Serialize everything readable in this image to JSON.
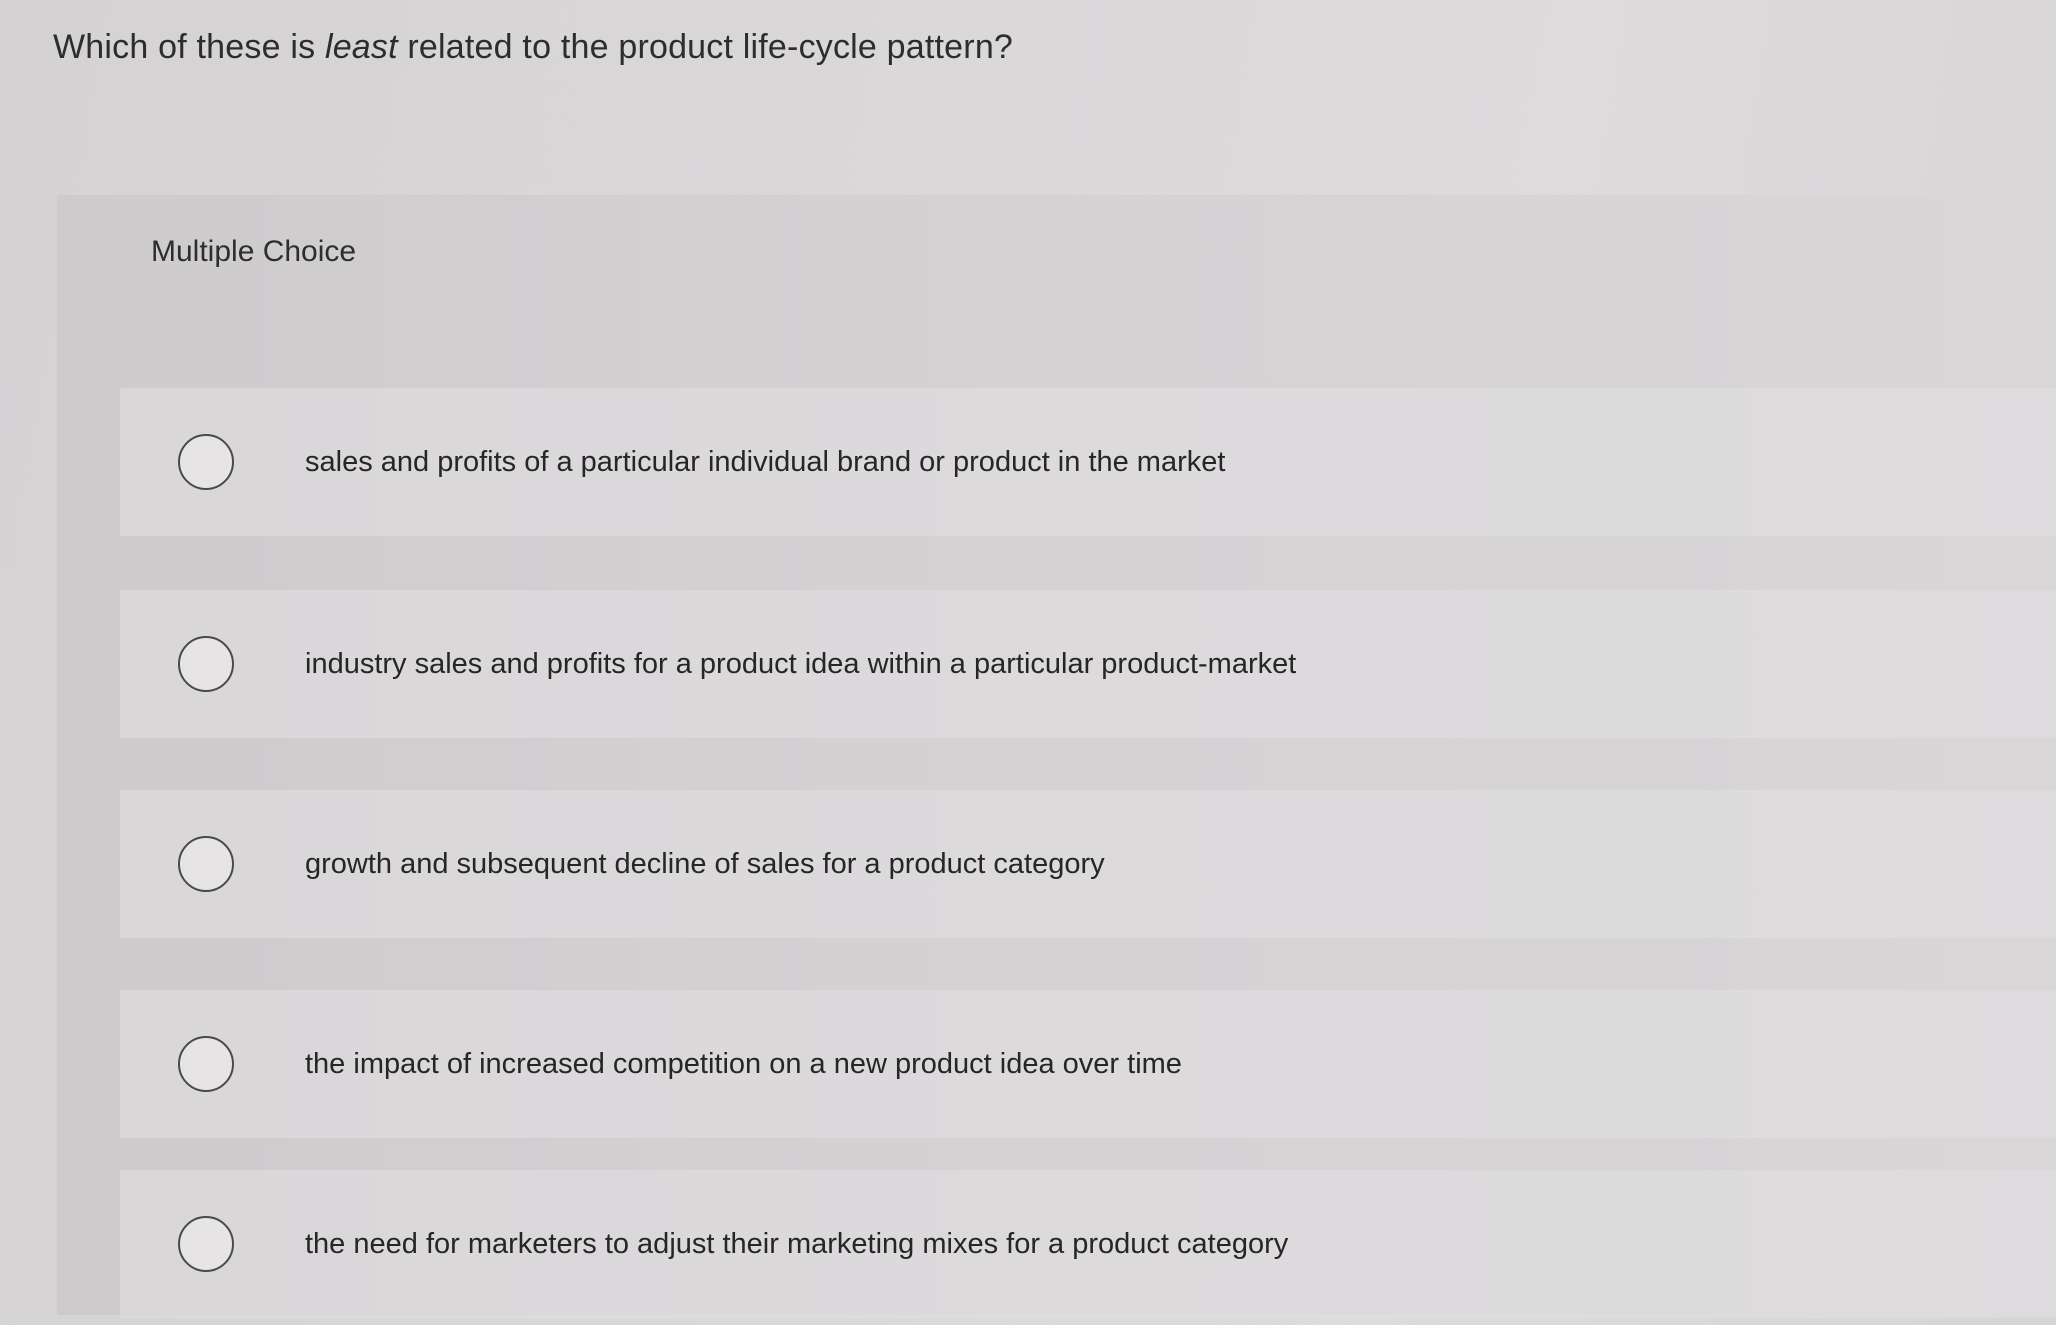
{
  "question": {
    "prefix": "Which of these is ",
    "emphasis": "least",
    "suffix": " related to the product life-cycle pattern?"
  },
  "section": {
    "label": "Multiple Choice"
  },
  "options": [
    {
      "text": "sales and profits of a particular individual brand or product in the market",
      "selected": false
    },
    {
      "text": "industry sales and profits for a product idea within a particular product-market",
      "selected": false
    },
    {
      "text": "growth and subsequent decline of sales for a product category",
      "selected": false
    },
    {
      "text": "the impact of increased competition on a new product idea over time",
      "selected": false
    },
    {
      "text": "the need for marketers to adjust their marketing mixes for a product category",
      "selected": false
    }
  ]
}
